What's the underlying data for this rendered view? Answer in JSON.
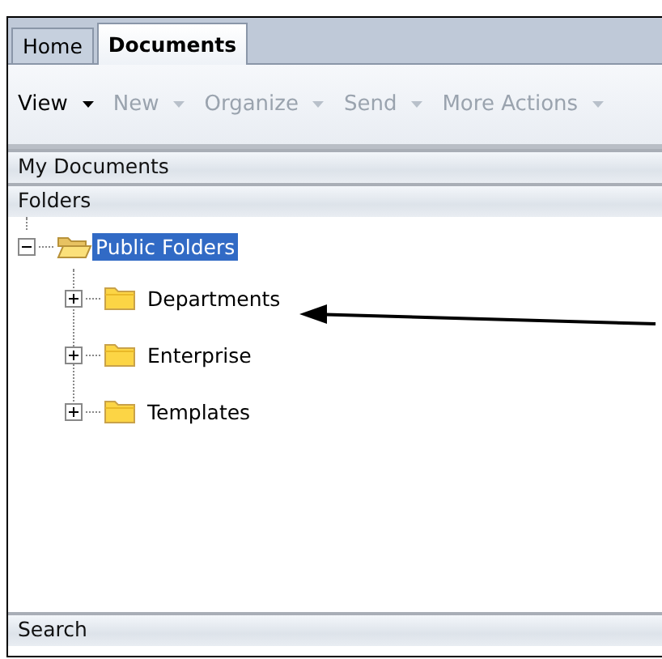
{
  "tabs": [
    {
      "label": "Home",
      "selected": false
    },
    {
      "label": "Documents",
      "selected": true
    }
  ],
  "toolbar": [
    {
      "label": "View",
      "disabled": false
    },
    {
      "label": "New",
      "disabled": true
    },
    {
      "label": "Organize",
      "disabled": true
    },
    {
      "label": "Send",
      "disabled": true
    },
    {
      "label": "More Actions",
      "disabled": true
    }
  ],
  "sections": [
    {
      "title": "My Documents"
    },
    {
      "title": "Folders"
    }
  ],
  "tree": [
    {
      "label": "Public Folders",
      "expanded": true,
      "selected": true,
      "children": [
        {
          "label": "Departments",
          "expanded": false,
          "selected": false
        },
        {
          "label": "Enterprise",
          "expanded": false,
          "selected": false
        },
        {
          "label": "Templates",
          "expanded": false,
          "selected": false
        }
      ]
    }
  ],
  "bottom_section": {
    "title": "Search"
  },
  "annotations": [
    {
      "kind": "arrow"
    }
  ]
}
